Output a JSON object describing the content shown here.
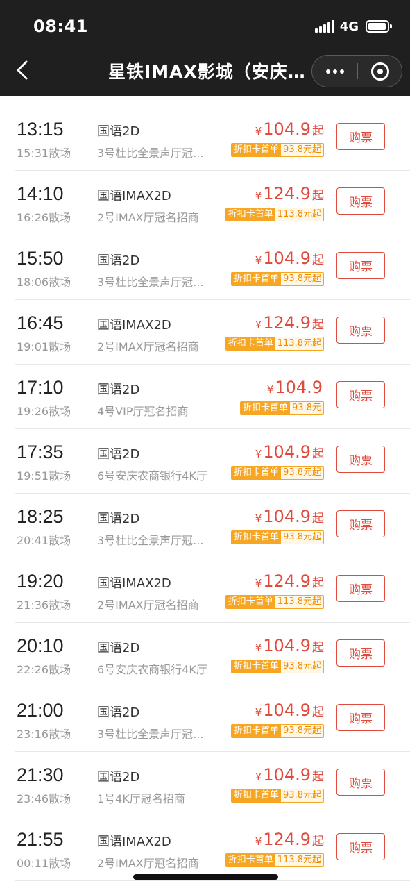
{
  "status_bar": {
    "time": "08:41",
    "network": "4G",
    "battery_level": 0.95
  },
  "nav": {
    "title": "星铁IMAX影城（安庆…",
    "back_icon": "chevron-left-icon",
    "more_icon": "more-dots-icon",
    "close_icon": "mini-program-close-icon"
  },
  "showtimes": [
    {
      "start": "13:15",
      "end": "15:31散场",
      "lang": "国语2D",
      "hall": "3号杜比全景声厅冠...",
      "price": "104.9",
      "from": "起",
      "discount_tag": "折扣卡首单",
      "discount_price": "93.8元起",
      "buy": "购票"
    },
    {
      "start": "14:10",
      "end": "16:26散场",
      "lang": "国语IMAX2D",
      "hall": "2号IMAX厅冠名招商",
      "price": "124.9",
      "from": "起",
      "discount_tag": "折扣卡首单",
      "discount_price": "113.8元起",
      "buy": "购票"
    },
    {
      "start": "15:50",
      "end": "18:06散场",
      "lang": "国语2D",
      "hall": "3号杜比全景声厅冠...",
      "price": "104.9",
      "from": "起",
      "discount_tag": "折扣卡首单",
      "discount_price": "93.8元起",
      "buy": "购票"
    },
    {
      "start": "16:45",
      "end": "19:01散场",
      "lang": "国语IMAX2D",
      "hall": "2号IMAX厅冠名招商",
      "price": "124.9",
      "from": "起",
      "discount_tag": "折扣卡首单",
      "discount_price": "113.8元起",
      "buy": "购票"
    },
    {
      "start": "17:10",
      "end": "19:26散场",
      "lang": "国语2D",
      "hall": "4号VIP厅冠名招商",
      "price": "104.9",
      "from": "",
      "discount_tag": "折扣卡首单",
      "discount_price": "93.8元",
      "buy": "购票"
    },
    {
      "start": "17:35",
      "end": "19:51散场",
      "lang": "国语2D",
      "hall": "6号安庆农商银行4K厅",
      "price": "104.9",
      "from": "起",
      "discount_tag": "折扣卡首单",
      "discount_price": "93.8元起",
      "buy": "购票"
    },
    {
      "start": "18:25",
      "end": "20:41散场",
      "lang": "国语2D",
      "hall": "3号杜比全景声厅冠...",
      "price": "104.9",
      "from": "起",
      "discount_tag": "折扣卡首单",
      "discount_price": "93.8元起",
      "buy": "购票"
    },
    {
      "start": "19:20",
      "end": "21:36散场",
      "lang": "国语IMAX2D",
      "hall": "2号IMAX厅冠名招商",
      "price": "124.9",
      "from": "起",
      "discount_tag": "折扣卡首单",
      "discount_price": "113.8元起",
      "buy": "购票"
    },
    {
      "start": "20:10",
      "end": "22:26散场",
      "lang": "国语2D",
      "hall": "6号安庆农商银行4K厅",
      "price": "104.9",
      "from": "起",
      "discount_tag": "折扣卡首单",
      "discount_price": "93.8元起",
      "buy": "购票"
    },
    {
      "start": "21:00",
      "end": "23:16散场",
      "lang": "国语2D",
      "hall": "3号杜比全景声厅冠...",
      "price": "104.9",
      "from": "起",
      "discount_tag": "折扣卡首单",
      "discount_price": "93.8元起",
      "buy": "购票"
    },
    {
      "start": "21:30",
      "end": "23:46散场",
      "lang": "国语2D",
      "hall": "1号4K厅冠名招商",
      "price": "104.9",
      "from": "起",
      "discount_tag": "折扣卡首单",
      "discount_price": "93.8元起",
      "buy": "购票"
    },
    {
      "start": "21:55",
      "end": "00:11散场",
      "lang": "国语IMAX2D",
      "hall": "2号IMAX厅冠名招商",
      "price": "124.9",
      "from": "起",
      "discount_tag": "折扣卡首单",
      "discount_price": "113.8元起",
      "buy": "购票"
    }
  ],
  "currency_symbol": "¥",
  "colors": {
    "price": "#e04a3c",
    "discount": "#f6a623",
    "topbar": "#1f1f1f"
  }
}
